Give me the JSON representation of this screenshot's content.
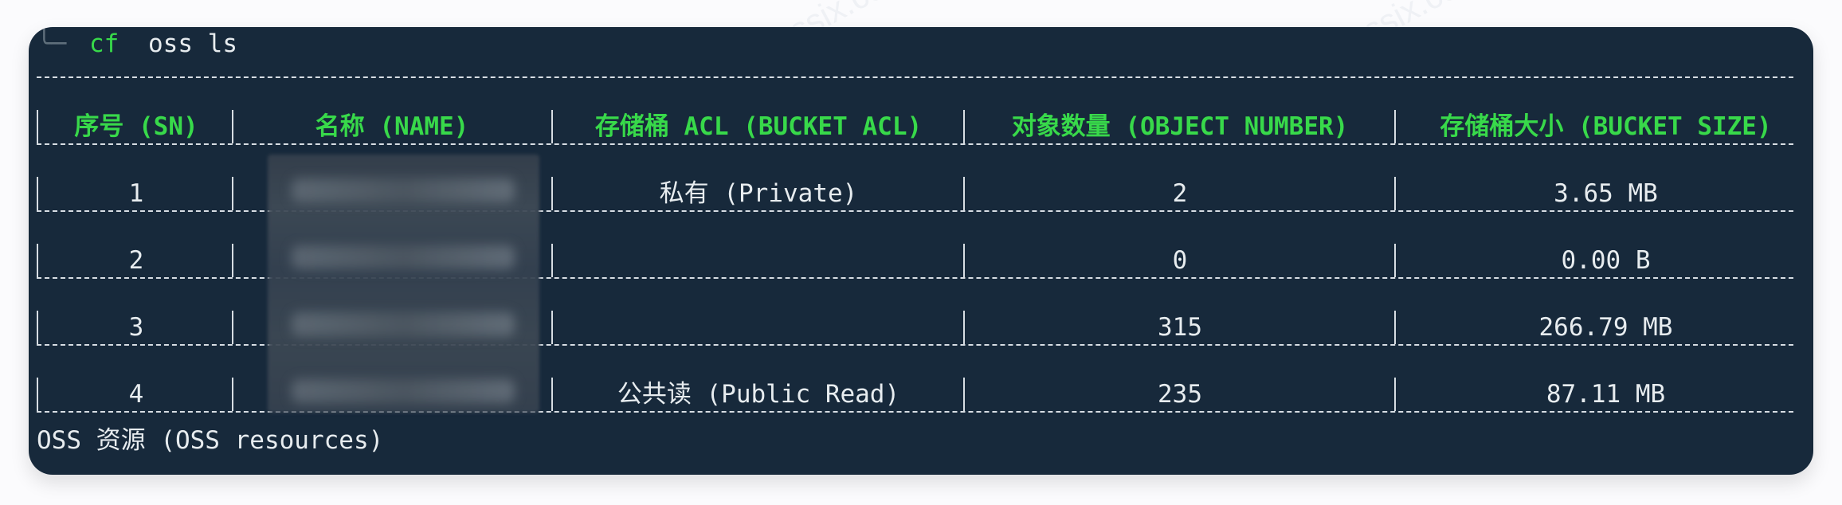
{
  "terminal": {
    "prompt_branch": "╰─",
    "command": "cf",
    "arguments": "oss ls"
  },
  "table": {
    "columns": [
      "序号 (SN)",
      "名称 (NAME)",
      "存储桶 ACL (BUCKET ACL)",
      "对象数量 (OBJECT NUMBER)",
      "存储桶大小 (BUCKET SIZE)"
    ],
    "rows": [
      {
        "sn": "1",
        "name": "",
        "acl": "私有 (Private)",
        "object_number": "2",
        "bucket_size": "3.65 MB"
      },
      {
        "sn": "2",
        "name": "",
        "acl": "",
        "object_number": "0",
        "bucket_size": "0.00 B"
      },
      {
        "sn": "3",
        "name": "",
        "acl": "",
        "object_number": "315",
        "bucket_size": "266.79 MB"
      },
      {
        "sn": "4",
        "name": "",
        "acl": "公共读 (Public Read)",
        "object_number": "235",
        "bucket_size": "87.11 MB"
      }
    ]
  },
  "footer": {
    "caption": "OSS 资源 (OSS resources)"
  },
  "watermark": {
    "text": "wiki.teamssix.com"
  },
  "colors": {
    "terminal_bg": "#17293b",
    "header_text": "#38d94a",
    "body_text": "#e7ecef"
  }
}
